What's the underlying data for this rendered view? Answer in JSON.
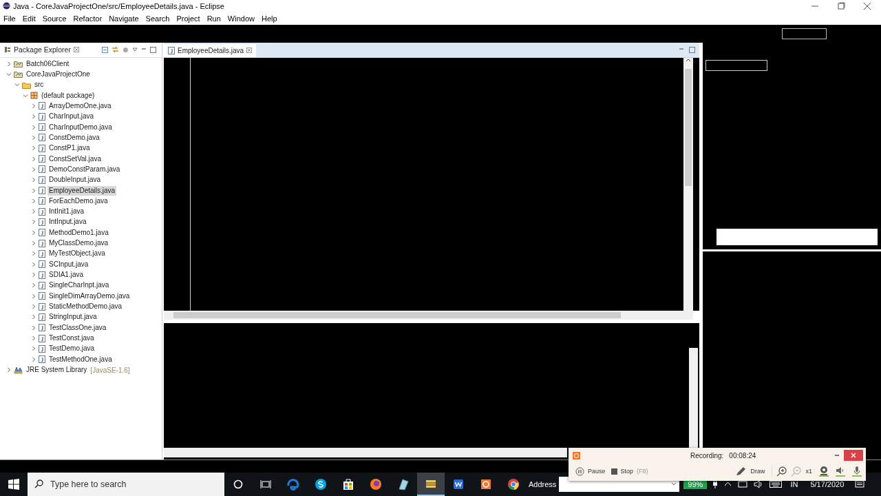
{
  "window": {
    "title": "Java - CoreJavaProjectOne/src/EmployeeDetails.java - Eclipse"
  },
  "menu": [
    "File",
    "Edit",
    "Source",
    "Refactor",
    "Navigate",
    "Search",
    "Project",
    "Run",
    "Window",
    "Help"
  ],
  "package_explorer": {
    "title": "Package Explorer",
    "tree": [
      {
        "label": "Batch06Client",
        "kind": "project",
        "expanded": false,
        "selected": false
      },
      {
        "label": "CoreJavaProjectOne",
        "kind": "project",
        "expanded": true,
        "selected": false,
        "children": [
          {
            "label": "src",
            "kind": "folder",
            "expanded": true,
            "selected": false,
            "children": [
              {
                "label": "(default package)",
                "kind": "package",
                "expanded": true,
                "selected": false,
                "children": [
                  {
                    "label": "ArrayDemoOne.java",
                    "kind": "file",
                    "expanded": false,
                    "selected": false
                  },
                  {
                    "label": "CharInput.java",
                    "kind": "file",
                    "expanded": false,
                    "selected": false
                  },
                  {
                    "label": "CharInputDemo.java",
                    "kind": "file",
                    "expanded": false,
                    "selected": false
                  },
                  {
                    "label": "ConstDemo.java",
                    "kind": "file",
                    "expanded": false,
                    "selected": false
                  },
                  {
                    "label": "ConstP1.java",
                    "kind": "file",
                    "expanded": false,
                    "selected": false
                  },
                  {
                    "label": "ConstSetVal.java",
                    "kind": "file",
                    "expanded": false,
                    "selected": false
                  },
                  {
                    "label": "DemoConstParam.java",
                    "kind": "file",
                    "expanded": false,
                    "selected": false
                  },
                  {
                    "label": "DoubleInput.java",
                    "kind": "file",
                    "expanded": false,
                    "selected": false
                  },
                  {
                    "label": "EmployeeDetails.java",
                    "kind": "file",
                    "expanded": false,
                    "selected": true
                  },
                  {
                    "label": "ForEachDemo.java",
                    "kind": "file",
                    "expanded": false,
                    "selected": false
                  },
                  {
                    "label": "IntInit1.java",
                    "kind": "file",
                    "expanded": false,
                    "selected": false
                  },
                  {
                    "label": "IntInput.java",
                    "kind": "file",
                    "expanded": false,
                    "selected": false
                  },
                  {
                    "label": "MethodDemo1.java",
                    "kind": "file",
                    "expanded": false,
                    "selected": false
                  },
                  {
                    "label": "MyClassDemo.java",
                    "kind": "file",
                    "expanded": false,
                    "selected": false
                  },
                  {
                    "label": "MyTestObject.java",
                    "kind": "file",
                    "expanded": false,
                    "selected": false
                  },
                  {
                    "label": "SCInput.java",
                    "kind": "file",
                    "expanded": false,
                    "selected": false
                  },
                  {
                    "label": "SDIA1.java",
                    "kind": "file",
                    "expanded": false,
                    "selected": false
                  },
                  {
                    "label": "SingleCharInpt.java",
                    "kind": "file",
                    "expanded": false,
                    "selected": false
                  },
                  {
                    "label": "SingleDimArrayDemo.java",
                    "kind": "file",
                    "expanded": false,
                    "selected": false
                  },
                  {
                    "label": "StaticMethodDemo.java",
                    "kind": "file",
                    "expanded": false,
                    "selected": false
                  },
                  {
                    "label": "StringInput.java",
                    "kind": "file",
                    "expanded": false,
                    "selected": false
                  },
                  {
                    "label": "TestClassOne.java",
                    "kind": "file",
                    "expanded": false,
                    "selected": false
                  },
                  {
                    "label": "TestConst.java",
                    "kind": "file",
                    "expanded": false,
                    "selected": false
                  },
                  {
                    "label": "TestDemo.java",
                    "kind": "file",
                    "expanded": false,
                    "selected": false
                  },
                  {
                    "label": "TestMethodOne.java",
                    "kind": "file",
                    "expanded": false,
                    "selected": false
                  }
                ]
              }
            ]
          }
        ]
      },
      {
        "label": "JRE System Library",
        "decoration": "[JavaSE-1.6]",
        "kind": "library",
        "expanded": false,
        "selected": false
      }
    ]
  },
  "editor": {
    "tabs": [
      {
        "label": "EmployeeDetails.java",
        "selected": true
      }
    ]
  },
  "taskbar": {
    "search": {
      "placeholder": "Type here to search"
    },
    "apps": [
      {
        "kind": "edge",
        "active": false
      },
      {
        "kind": "skype",
        "active": false
      },
      {
        "kind": "store",
        "active": false
      },
      {
        "kind": "firefox",
        "active": false
      },
      {
        "kind": "notepad",
        "active": false
      },
      {
        "kind": "explorer",
        "active": true
      },
      {
        "kind": "writer",
        "active": false
      },
      {
        "kind": "recorder",
        "active": false
      },
      {
        "kind": "chrome",
        "active": false
      }
    ],
    "address_label": "Address",
    "battery": "99%",
    "language": "IN",
    "date": "5/17/2020"
  },
  "recorder": {
    "status": "Recording:",
    "time": "00:08:24",
    "buttons": [
      {
        "label": "Pause",
        "kind": "pause"
      },
      {
        "label": "Stop",
        "hint": "(F8)",
        "kind": "stop"
      },
      {
        "label": "Draw",
        "kind": "draw"
      }
    ],
    "zoom": "x1"
  }
}
